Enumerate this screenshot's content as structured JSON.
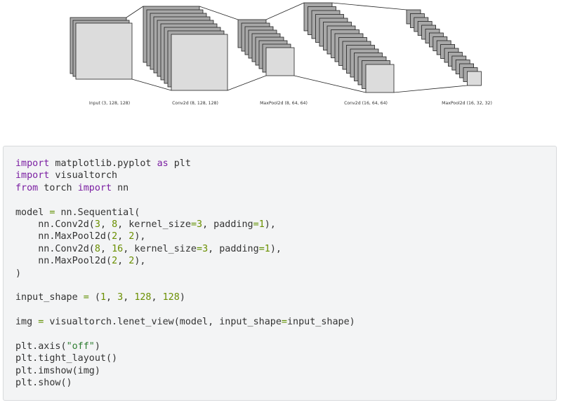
{
  "diagram": {
    "layers": [
      {
        "label": "Input (3, 128, 128)"
      },
      {
        "label": "Conv2d (8, 128, 128)"
      },
      {
        "label": "MaxPool2d (8, 64, 64)"
      },
      {
        "label": "Conv2d (16, 64, 64)"
      },
      {
        "label": "MaxPool2d (16, 32, 32)"
      }
    ],
    "colors": {
      "back": "#a8a8a8",
      "front": "#dcdcdc",
      "stroke": "#222222"
    }
  },
  "code": {
    "language": "python",
    "lines": [
      [
        {
          "t": "import",
          "c": "kw"
        },
        {
          "t": " matplotlib.pyplot "
        },
        {
          "t": "as",
          "c": "kw"
        },
        {
          "t": " plt"
        }
      ],
      [
        {
          "t": "import",
          "c": "kw"
        },
        {
          "t": " visualtorch"
        }
      ],
      [
        {
          "t": "from",
          "c": "kw"
        },
        {
          "t": " torch "
        },
        {
          "t": "import",
          "c": "kw"
        },
        {
          "t": " nn"
        }
      ],
      [],
      [
        {
          "t": "model "
        },
        {
          "t": "=",
          "c": "op"
        },
        {
          "t": " nn.Sequential("
        }
      ],
      [
        {
          "t": "    nn.Conv2d("
        },
        {
          "t": "3",
          "c": "num"
        },
        {
          "t": ", "
        },
        {
          "t": "8",
          "c": "num"
        },
        {
          "t": ", kernel_size"
        },
        {
          "t": "=",
          "c": "op"
        },
        {
          "t": "3",
          "c": "num"
        },
        {
          "t": ", padding"
        },
        {
          "t": "=",
          "c": "op"
        },
        {
          "t": "1",
          "c": "num"
        },
        {
          "t": "),"
        }
      ],
      [
        {
          "t": "    nn.MaxPool2d("
        },
        {
          "t": "2",
          "c": "num"
        },
        {
          "t": ", "
        },
        {
          "t": "2",
          "c": "num"
        },
        {
          "t": "),"
        }
      ],
      [
        {
          "t": "    nn.Conv2d("
        },
        {
          "t": "8",
          "c": "num"
        },
        {
          "t": ", "
        },
        {
          "t": "16",
          "c": "num"
        },
        {
          "t": ", kernel_size"
        },
        {
          "t": "=",
          "c": "op"
        },
        {
          "t": "3",
          "c": "num"
        },
        {
          "t": ", padding"
        },
        {
          "t": "=",
          "c": "op"
        },
        {
          "t": "1",
          "c": "num"
        },
        {
          "t": "),"
        }
      ],
      [
        {
          "t": "    nn.MaxPool2d("
        },
        {
          "t": "2",
          "c": "num"
        },
        {
          "t": ", "
        },
        {
          "t": "2",
          "c": "num"
        },
        {
          "t": "),"
        }
      ],
      [
        {
          "t": ")"
        }
      ],
      [],
      [
        {
          "t": "input_shape "
        },
        {
          "t": "=",
          "c": "op"
        },
        {
          "t": " ("
        },
        {
          "t": "1",
          "c": "num"
        },
        {
          "t": ", "
        },
        {
          "t": "3",
          "c": "num"
        },
        {
          "t": ", "
        },
        {
          "t": "128",
          "c": "num"
        },
        {
          "t": ", "
        },
        {
          "t": "128",
          "c": "num"
        },
        {
          "t": ")"
        }
      ],
      [],
      [
        {
          "t": "img "
        },
        {
          "t": "=",
          "c": "op"
        },
        {
          "t": " visualtorch.lenet_view(model, input_shape"
        },
        {
          "t": "=",
          "c": "op"
        },
        {
          "t": "input_shape)"
        }
      ],
      [],
      [
        {
          "t": "plt.axis("
        },
        {
          "t": "\"off\"",
          "c": "str"
        },
        {
          "t": ")"
        }
      ],
      [
        {
          "t": "plt.tight_layout()"
        }
      ],
      [
        {
          "t": "plt.imshow(img)"
        }
      ],
      [
        {
          "t": "plt.show()"
        }
      ]
    ]
  }
}
